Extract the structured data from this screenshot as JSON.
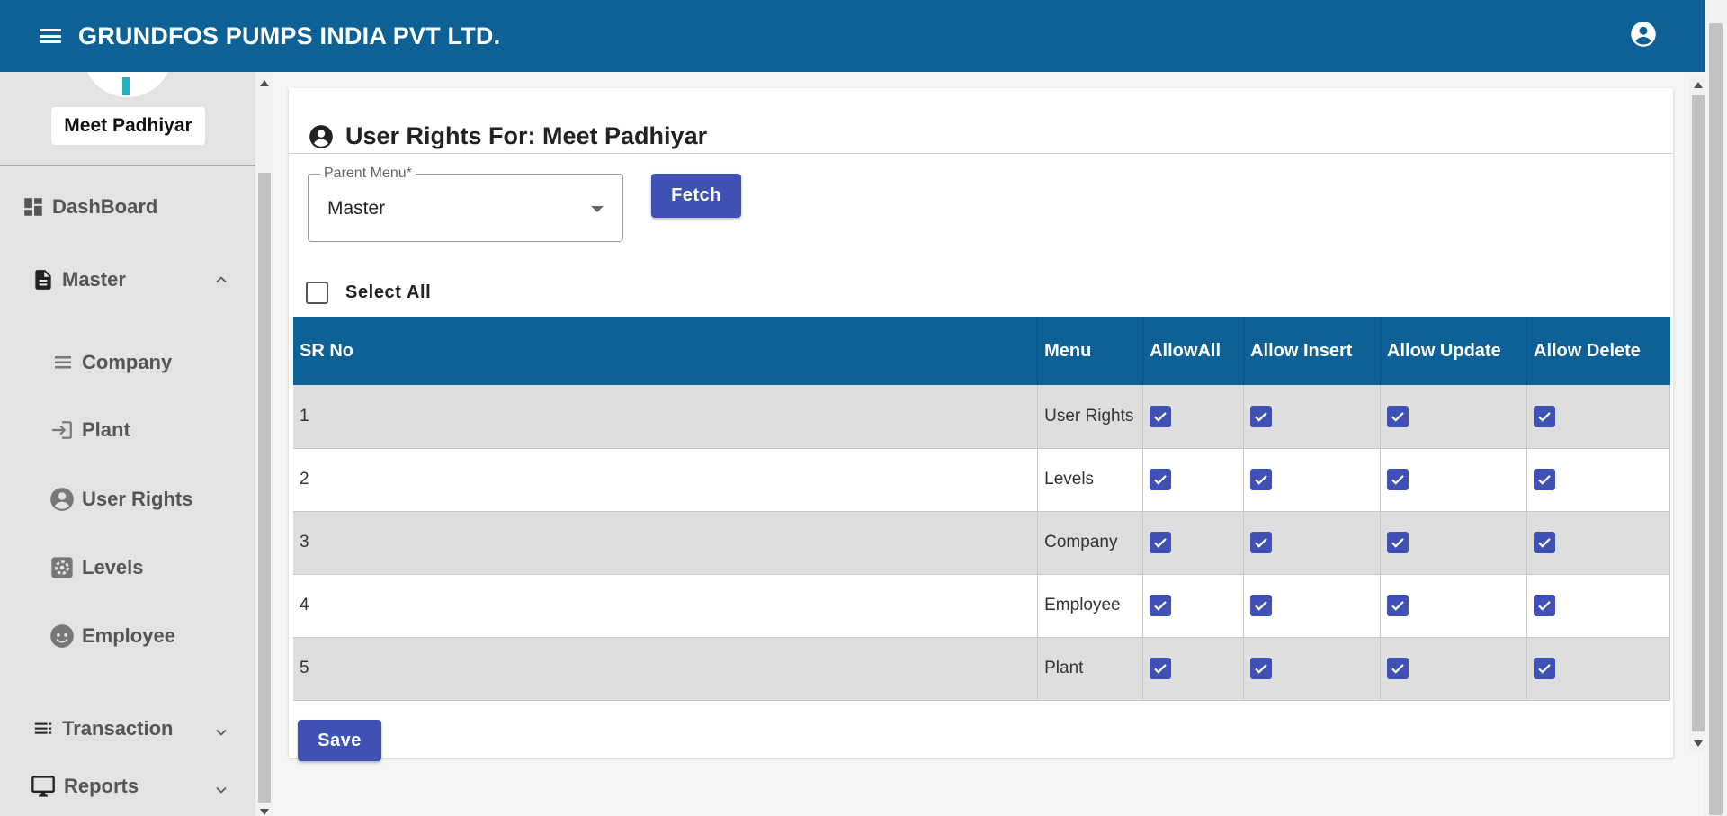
{
  "app": {
    "title": "GRUNDFOS PUMPS INDIA PVT LTD."
  },
  "sidebar": {
    "user_name": "Meet Padhiyar",
    "dashboard": "DashBoard",
    "master": "Master",
    "master_items": [
      "Company",
      "Plant",
      "User Rights",
      "Levels",
      "Employee"
    ],
    "transaction": "Transaction",
    "reports": "Reports"
  },
  "page": {
    "title": "User Rights For: Meet Padhiyar",
    "parent_menu_label": "Parent Menu*",
    "parent_menu_value": "Master",
    "fetch_label": "Fetch",
    "select_all_label": "Select All",
    "save_label": "Save"
  },
  "table": {
    "columns": [
      "SR No",
      "Menu",
      "AllowAll",
      "Allow Insert",
      "Allow Update",
      "Allow Delete"
    ],
    "rows": [
      {
        "sr": "1",
        "menu": "User Rights",
        "allow_all": true,
        "insert": true,
        "update": true,
        "delete": true
      },
      {
        "sr": "2",
        "menu": "Levels",
        "allow_all": true,
        "insert": true,
        "update": true,
        "delete": true
      },
      {
        "sr": "3",
        "menu": "Company",
        "allow_all": true,
        "insert": true,
        "update": true,
        "delete": true
      },
      {
        "sr": "4",
        "menu": "Employee",
        "allow_all": true,
        "insert": true,
        "update": true,
        "delete": true
      },
      {
        "sr": "5",
        "menu": "Plant",
        "allow_all": true,
        "insert": true,
        "update": true,
        "delete": true
      }
    ]
  },
  "colors": {
    "primary": "#0d6196",
    "button": "#3f51b5",
    "sidebar_bg": "#e3e3e3"
  }
}
